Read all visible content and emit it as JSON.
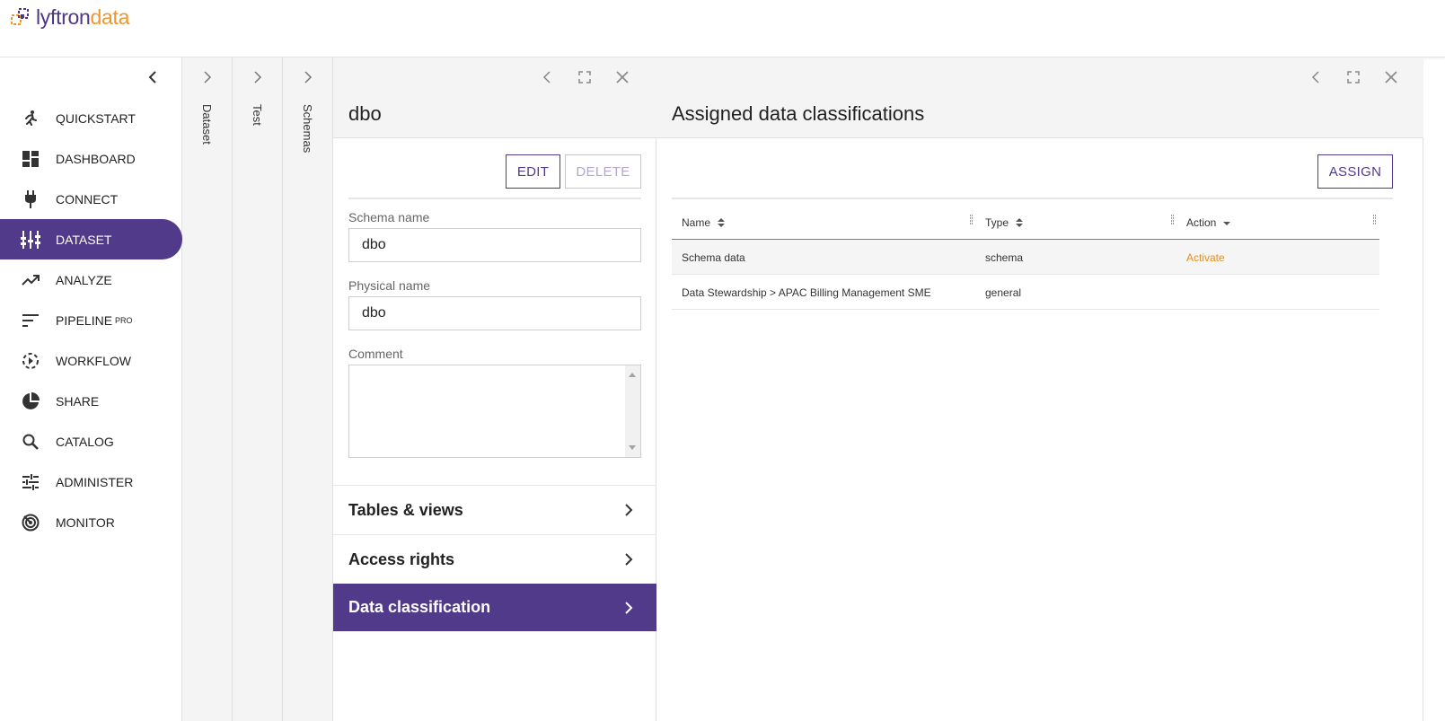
{
  "app": {
    "logo_part1": "lyftron",
    "logo_part2": "data"
  },
  "colors": {
    "accent": "#523a8a",
    "brand_orange": "#f0962a",
    "action_orange": "#ec8c1a"
  },
  "sidebar": {
    "items": [
      {
        "label": "QUICKSTART",
        "icon": "run-icon"
      },
      {
        "label": "DASHBOARD",
        "icon": "dashboard-icon"
      },
      {
        "label": "CONNECT",
        "icon": "plug-icon"
      },
      {
        "label": "DATASET",
        "icon": "dataset-icon",
        "active": true
      },
      {
        "label": "ANALYZE",
        "icon": "trending-up-icon"
      },
      {
        "label": "PIPELINE",
        "badge": "PRO",
        "icon": "pipeline-icon"
      },
      {
        "label": "WORKFLOW",
        "icon": "workflow-icon"
      },
      {
        "label": "SHARE",
        "icon": "pie-icon"
      },
      {
        "label": "CATALOG",
        "icon": "search-icon"
      },
      {
        "label": "ADMINISTER",
        "icon": "sliders-icon"
      },
      {
        "label": "MONITOR",
        "icon": "radar-icon"
      }
    ]
  },
  "panels": {
    "collapsed": [
      "Dataset",
      "Test",
      "Schemas"
    ]
  },
  "detail": {
    "title": "dbo",
    "edit_label": "EDIT",
    "delete_label": "DELETE",
    "schema_name_label": "Schema name",
    "schema_name_value": "dbo",
    "physical_name_label": "Physical name",
    "physical_name_value": "dbo",
    "comment_label": "Comment",
    "comment_value": "",
    "sections": [
      "Tables & views",
      "Access rights",
      "Data classification"
    ]
  },
  "classifications": {
    "title": "Assigned data classifications",
    "assign_label": "ASSIGN",
    "columns": [
      "Name",
      "Type",
      "Action"
    ],
    "rows": [
      {
        "name": "Schema data",
        "type": "schema",
        "action": "Activate"
      },
      {
        "name": "Data Stewardship > APAC Billing Management SME",
        "type": "general",
        "action": ""
      }
    ]
  }
}
